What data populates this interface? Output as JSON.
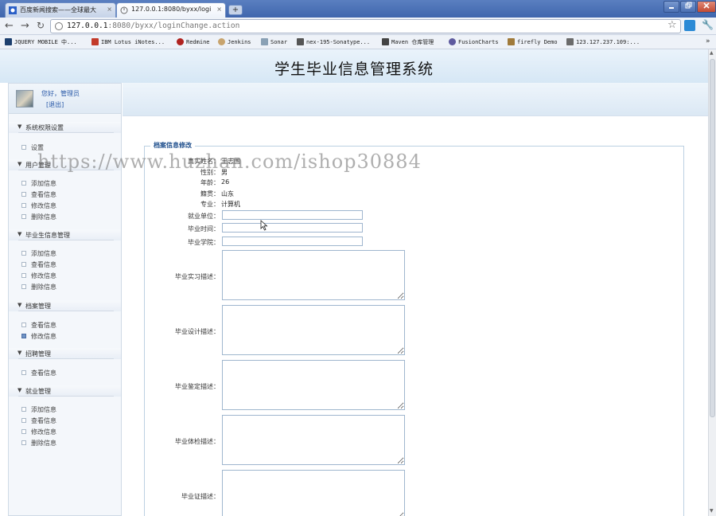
{
  "browser": {
    "tabs": [
      {
        "title": "百度新闻搜索——全球最大",
        "active": false
      },
      {
        "title": "127.0.0.1:8080/byxx/logi",
        "active": true
      }
    ],
    "close_glyph": "×",
    "new_tab_glyph": "+",
    "url_host": "127.0.0.1",
    "url_rest": ":8080/byxx/loginChange.action",
    "bookmarks": [
      {
        "label": "JQUERY MOBILE 中...",
        "color": "#1c3f6e"
      },
      {
        "label": "IBM Lotus iNotes...",
        "color": "#c33b2a"
      },
      {
        "label": "Redmine",
        "color": "#b0221f"
      },
      {
        "label": "Jenkins",
        "color": "#c8a46e"
      },
      {
        "label": "Sonar",
        "color": "#8aa1b5"
      },
      {
        "label": "nex-195-Sonatype...",
        "color": "#555555"
      },
      {
        "label": "Maven 仓库管理",
        "color": "#444444"
      },
      {
        "label": "FusionCharts",
        "color": "#5e5a9e"
      },
      {
        "label": "firefly Demo",
        "color": "#a07a3a"
      },
      {
        "label": "123.127.237.109:...",
        "color": "#6b6b6b"
      }
    ],
    "more_glyph": "»"
  },
  "header": {
    "title": "学生毕业信息管理系统"
  },
  "watermark": "https://www.huzhan.com/ishop30884",
  "sidebar": {
    "greeting": "您好，管理员",
    "logout": "[退出]",
    "groups": [
      {
        "label": "系统权限设置",
        "items": [
          {
            "label": "设置",
            "selected": false
          }
        ]
      },
      {
        "label": "用户管理",
        "items": [
          {
            "label": "添加信息",
            "selected": false
          },
          {
            "label": "查看信息",
            "selected": false
          },
          {
            "label": "修改信息",
            "selected": false
          },
          {
            "label": "删除信息",
            "selected": false
          }
        ]
      },
      {
        "label": "毕业生信息管理",
        "items": [
          {
            "label": "添加信息",
            "selected": false
          },
          {
            "label": "查看信息",
            "selected": false
          },
          {
            "label": "修改信息",
            "selected": false
          },
          {
            "label": "删除信息",
            "selected": false
          }
        ]
      },
      {
        "label": "档案管理",
        "items": [
          {
            "label": "查看信息",
            "selected": false
          },
          {
            "label": "修改信息",
            "selected": true
          }
        ]
      },
      {
        "label": "招聘管理",
        "items": [
          {
            "label": "查看信息",
            "selected": false
          }
        ]
      },
      {
        "label": "就业管理",
        "items": [
          {
            "label": "添加信息",
            "selected": false
          },
          {
            "label": "查看信息",
            "selected": false
          },
          {
            "label": "修改信息",
            "selected": false
          },
          {
            "label": "删除信息",
            "selected": false
          }
        ]
      }
    ]
  },
  "form": {
    "legend": "档案信息修改",
    "static_fields": [
      {
        "label": "真实姓名：",
        "value": "王志国"
      },
      {
        "label": "性别：",
        "value": "男"
      },
      {
        "label": "年龄：",
        "value": "26"
      },
      {
        "label": "籍贯：",
        "value": "山东"
      },
      {
        "label": "专业：",
        "value": "计算机"
      }
    ],
    "inputs": [
      {
        "label": "就业单位：",
        "value": ""
      },
      {
        "label": "毕业时间：",
        "value": ""
      },
      {
        "label": "毕业学院：",
        "value": ""
      }
    ],
    "textareas": [
      {
        "label": "毕业实习描述：",
        "value": ""
      },
      {
        "label": "毕业设计描述：",
        "value": ""
      },
      {
        "label": "毕业鉴定描述：",
        "value": ""
      },
      {
        "label": "毕业体检描述：",
        "value": ""
      },
      {
        "label": "毕业证描述：",
        "value": ""
      }
    ]
  }
}
